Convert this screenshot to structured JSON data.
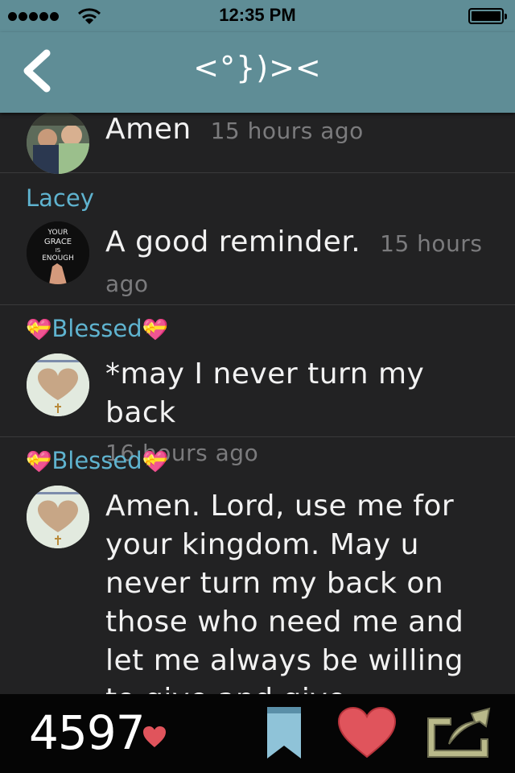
{
  "status": {
    "time": "12:35 PM"
  },
  "nav": {
    "title": "<°})><"
  },
  "comments": [
    {
      "username": "",
      "text": "Amen",
      "time": "15 hours ago"
    },
    {
      "username": "Lacey",
      "text": "A good reminder.",
      "time": "15 hours ago",
      "avatar_text": [
        "YOUR",
        "GRACE",
        "IS",
        "ENOUGH"
      ]
    },
    {
      "username_prefix": "💝",
      "username": "Blessed",
      "username_suffix": "💝",
      "text": "*may I never turn my back",
      "time": "16 hours ago"
    },
    {
      "username_prefix": "💝",
      "username": "Blessed",
      "username_suffix": "💝",
      "text": "Amen. Lord, use me for your kingdom. May u never turn my back on those who need me and let me always be willing to give and give abundantly. Fo",
      "time": ""
    }
  ],
  "footer": {
    "like_count": "4597"
  },
  "colors": {
    "bar": "#5f8d96",
    "username": "#5fb3cf",
    "bookmark": "#8fc3d8",
    "heart": "#e0545c",
    "share": "#b9b98a"
  }
}
